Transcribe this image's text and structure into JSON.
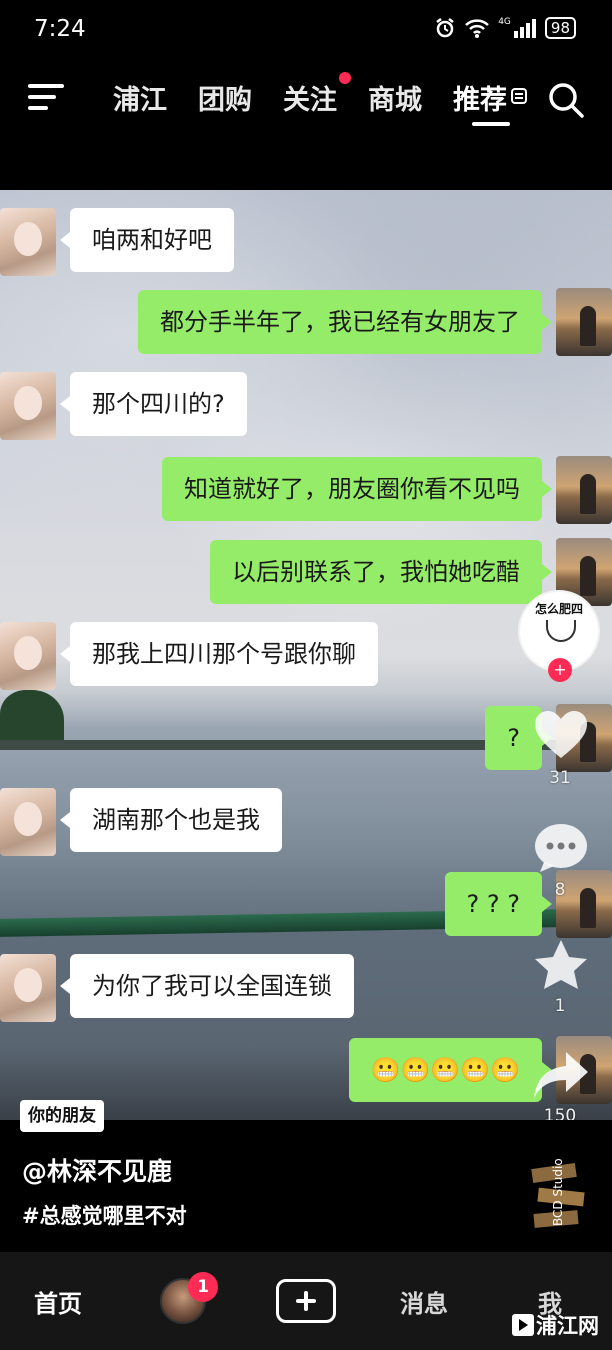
{
  "status_bar": {
    "time": "7:24",
    "battery": "98",
    "network": "4G"
  },
  "top_nav": {
    "tabs": [
      {
        "label": "浦江"
      },
      {
        "label": "团购"
      },
      {
        "label": "关注"
      },
      {
        "label": "商城"
      },
      {
        "label": "推荐"
      }
    ],
    "active_tab": "推荐",
    "badge_color": "#ff2b55"
  },
  "chat": {
    "messages": [
      {
        "side": "left",
        "text": "咱两和好吧"
      },
      {
        "side": "right",
        "text": "都分手半年了，我已经有女朋友了"
      },
      {
        "side": "left",
        "text": "那个四川的?"
      },
      {
        "side": "right",
        "text": "知道就好了，朋友圈你看不见吗"
      },
      {
        "side": "right",
        "text": "以后别联系了，我怕她吃醋"
      },
      {
        "side": "left",
        "text": "那我上四川那个号跟你聊"
      },
      {
        "side": "right",
        "text": "?"
      },
      {
        "side": "left",
        "text": "湖南那个也是我"
      },
      {
        "side": "right",
        "text": "? ? ?"
      },
      {
        "side": "left",
        "text": "为你了我可以全国连锁"
      },
      {
        "side": "right",
        "text": "😬😬😬😬😬"
      }
    ],
    "bubble_colors": {
      "left": "#ffffff",
      "right": "#95ec69"
    }
  },
  "side_actions": {
    "author_badge_title": "怎么肥四",
    "likes": "31",
    "comments": "8",
    "favorites": "1",
    "shares": "150"
  },
  "caption": {
    "friend_tag": "你的朋友",
    "author": "@林深不见鹿",
    "hashtag": "#总感觉哪里不对",
    "music_label": "BCD Studio"
  },
  "bottom_nav": {
    "home": "首页",
    "notification_count": "1",
    "messages": "消息",
    "me": "我"
  },
  "watermark": "浦江网"
}
